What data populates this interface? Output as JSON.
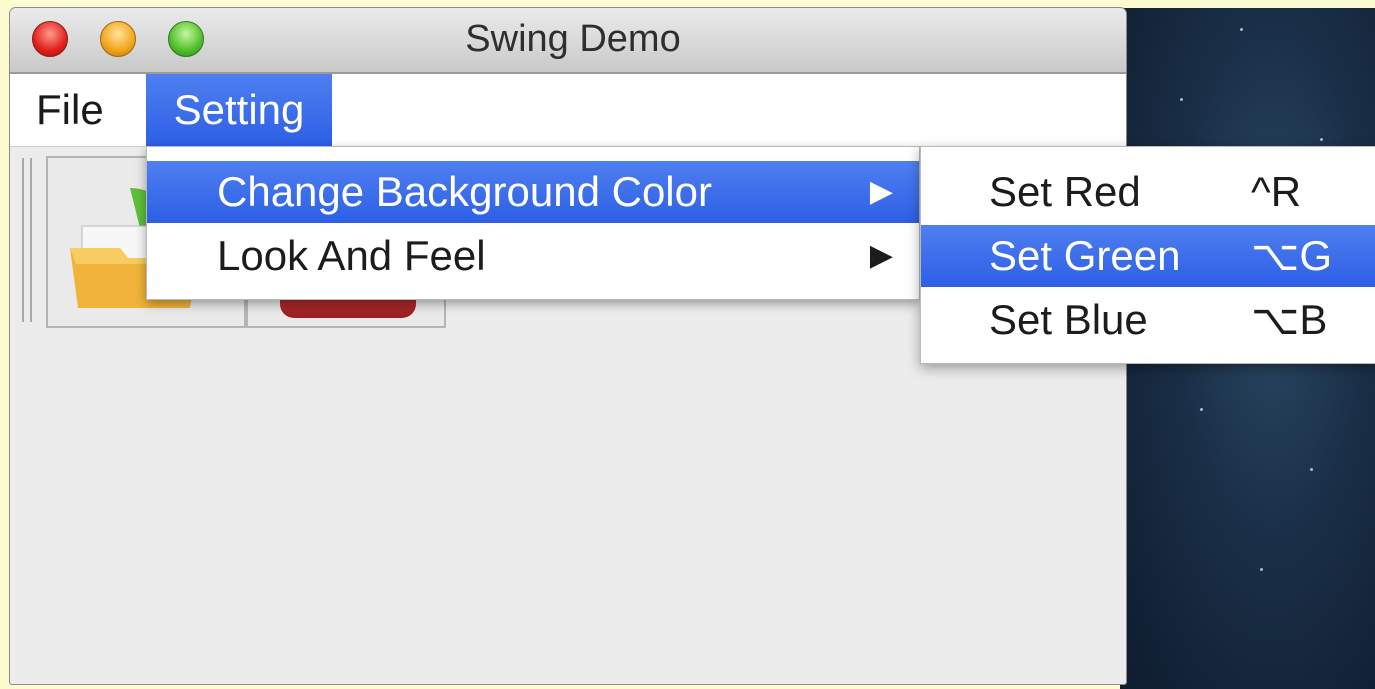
{
  "window": {
    "title": "Swing Demo"
  },
  "menubar": {
    "items": [
      {
        "label": "File"
      },
      {
        "label": "Setting"
      }
    ]
  },
  "setting_menu": {
    "items": [
      {
        "label": "Change Background Color",
        "arrow": "▶",
        "highlighted": true
      },
      {
        "label": "Look And Feel",
        "arrow": "▶",
        "highlighted": false
      }
    ]
  },
  "color_submenu": {
    "items": [
      {
        "label": "Set Red",
        "shortcut": "^R",
        "highlighted": false
      },
      {
        "label": "Set Green",
        "shortcut": "⌥G",
        "highlighted": true
      },
      {
        "label": "Set Blue",
        "shortcut": "⌥B",
        "highlighted": false
      }
    ]
  },
  "toolbar": {
    "buttons": [
      {
        "icon": "folder-open-icon"
      },
      {
        "icon": "stop-icon"
      }
    ]
  },
  "colors": {
    "highlight": "#3a6ff0",
    "background": "#fdfbd0"
  }
}
